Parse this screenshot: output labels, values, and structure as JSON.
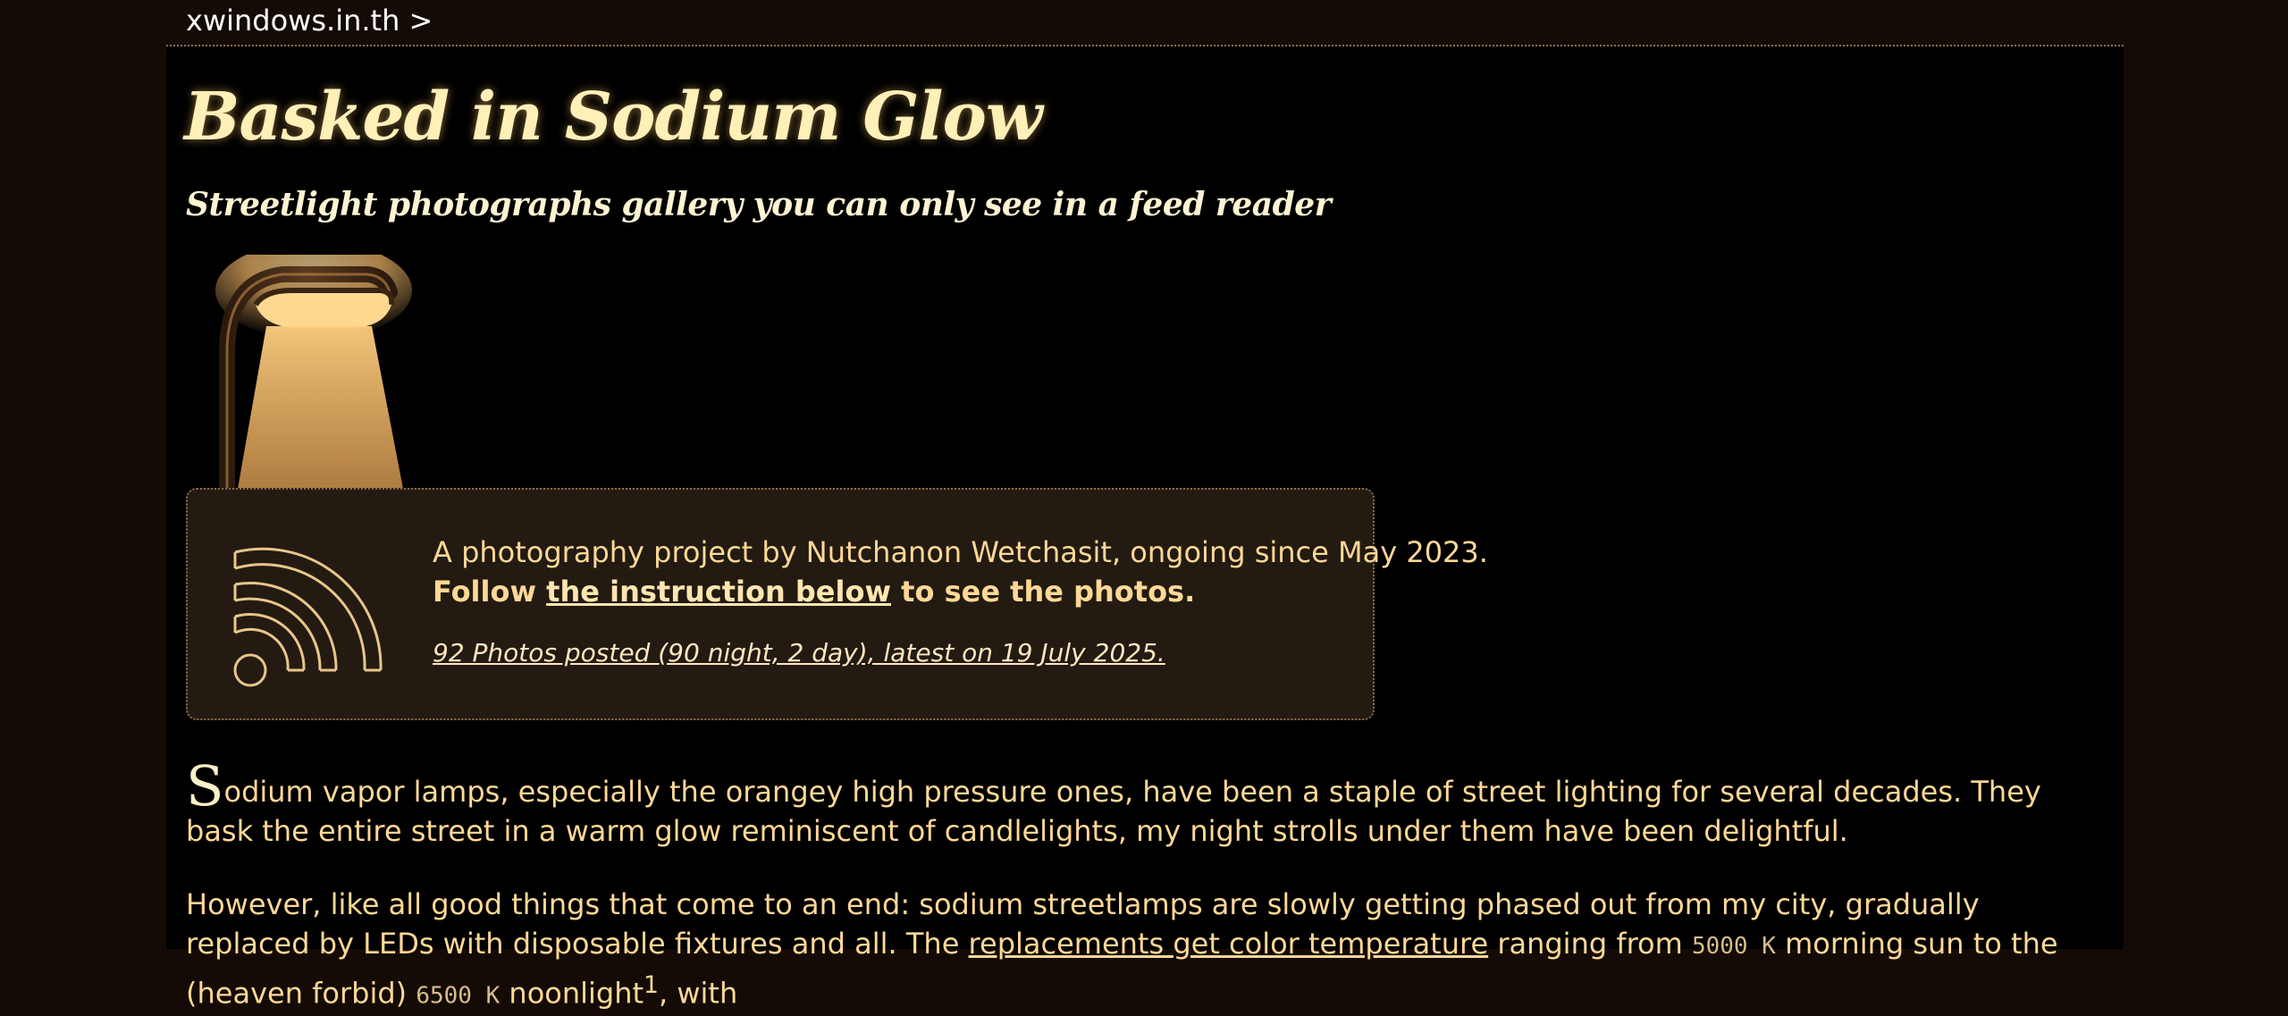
{
  "breadcrumb": {
    "text": "xwindows.in.th >"
  },
  "header": {
    "title": "Basked in Sodium Glow",
    "subtitle": "Streetlight photographs gallery you can only see in a feed reader"
  },
  "intro_card": {
    "icon": "rss-feed-icon",
    "line1": "A photography project by Nutchanon Wetchasit, ongoing since May 2023.",
    "line2_prefix": "Follow ",
    "line2_link": "the instruction below",
    "line2_suffix": " to see the photos.",
    "stats": "92 Photos posted (90 night, 2 day), latest on 19 July 2025."
  },
  "paragraphs": {
    "p1_dropcap": "S",
    "p1_rest": "odium vapor lamps, especially the orangey high pressure ones, have been a staple of street lighting for several decades. They bask the entire street in a warm glow reminiscent of candlelights, my night strolls under them have been delightful.",
    "p2_part1": "However, like all good things that come to an end: sodium streetlamps are slowly getting phased out from my city, gradually replaced by LEDs with disposable fixtures and all. The ",
    "p2_link": "replacements get color temperature",
    "p2_part2": " ranging from ",
    "p2_k1": "5000 K",
    "p2_part3": " morning sun to the (heaven forbid) ",
    "p2_k2": "6500 K",
    "p2_part4": " noonlight",
    "p2_footnote": "1",
    "p2_part5": ", with"
  },
  "colors": {
    "background": "#000000",
    "outer_background": "#140b06",
    "text": "#ffd896",
    "title": "#fff0b8",
    "card_background": "#231b12",
    "card_border": "#8a6e4a"
  }
}
